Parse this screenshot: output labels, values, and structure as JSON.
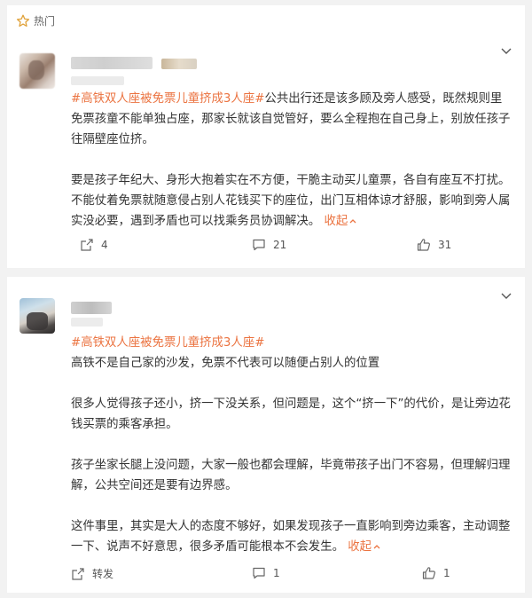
{
  "header": {
    "hot_label": "热门"
  },
  "posts": [
    {
      "tag": "#高铁双人座被免票儿童挤成3人座#",
      "paragraphs": [
        "公共出行还是该多顾及旁人感受，既然规则里免票孩童不能单独占座，那家长就该自觉管好，要么全程抱在自己身上，别放任孩子往隔壁座位挤。",
        "要是孩子年纪大、身形大抱着实在不方便，干脆主动买儿童票，各自有座互不打扰。不能仗着免票就随意侵占别人花钱买下的座位，出门互相体谅才舒服，影响到旁人属实没必要，遇到矛盾也可以找乘务员协调解决。"
      ],
      "collapse_label": "收起",
      "share_count": "4",
      "comment_count": "21",
      "like_count": "31"
    },
    {
      "tag": "#高铁双人座被免票儿童挤成3人座#",
      "paragraphs": [
        "高铁不是自己家的沙发，免票不代表可以随便占别人的位置",
        "很多人觉得孩子还小，挤一下没关系，但问题是，这个“挤一下”的代价，是让旁边花钱买票的乘客承担。",
        "孩子坐家长腿上没问题，大家一般也都会理解，毕竟带孩子出门不容易，但理解归理解，公共空间还是要有边界感。",
        "这件事里，其实是大人的态度不够好，如果发现孩子一直影响到旁边乘客，主动调整一下、说声不好意思，很多矛盾可能根本不会发生。"
      ],
      "collapse_label": "收起",
      "share_label": "转发",
      "comment_count": "1",
      "like_count": "1"
    }
  ],
  "colors": {
    "accent": "#eb7340",
    "text": "#333333",
    "muted": "#555555",
    "background": "#f2f2f2",
    "card": "#ffffff"
  },
  "icons": [
    "hot-icon",
    "chevron-down-icon",
    "share-icon",
    "comment-icon",
    "like-icon",
    "caret-up-icon"
  ]
}
